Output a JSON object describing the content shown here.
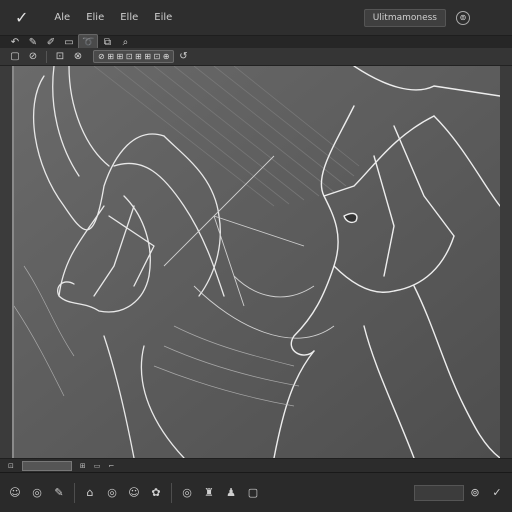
{
  "menubar": {
    "logo_glyph": "✓",
    "items": [
      "Ale",
      "Elie",
      "Elle",
      "Eile"
    ],
    "doc_title": "Ulitmamoness",
    "settings_glyph": "⊚"
  },
  "toolbar": {
    "tools": [
      {
        "name": "undo-icon",
        "glyph": "↶"
      },
      {
        "name": "brush-icon",
        "glyph": "✎"
      },
      {
        "name": "pencil-icon",
        "glyph": "✐"
      },
      {
        "name": "eraser-icon",
        "glyph": "▭"
      },
      {
        "name": "lasso-icon",
        "glyph": "➰"
      },
      {
        "name": "layer-icon",
        "glyph": "⧉"
      },
      {
        "name": "zoom-icon",
        "glyph": "⌕"
      }
    ]
  },
  "optionsbar": {
    "leading": [
      "▢",
      "⊘",
      "⊡",
      "⊗"
    ],
    "field_label": "⊘ ⊞ ⊞ ⊡ ⊞ ⊞ ⊡ ⊕",
    "trailing": [
      "↺"
    ]
  },
  "statusbar": {
    "left_glyph": "⊡",
    "zoom_glyph": "⊞",
    "items": [
      "▭",
      "⌐"
    ]
  },
  "bottombar": {
    "icons": [
      "☺",
      "◎",
      "✎",
      "⌂",
      "◎",
      "☺",
      "✿",
      "◎",
      "♜",
      "♟",
      "▢"
    ],
    "right_icons": [
      "⊚",
      "✓"
    ]
  },
  "colors": {
    "accent": "#4a4a4a",
    "canvas_bg": "#5a5a5a",
    "line": "#e6e6e6"
  }
}
